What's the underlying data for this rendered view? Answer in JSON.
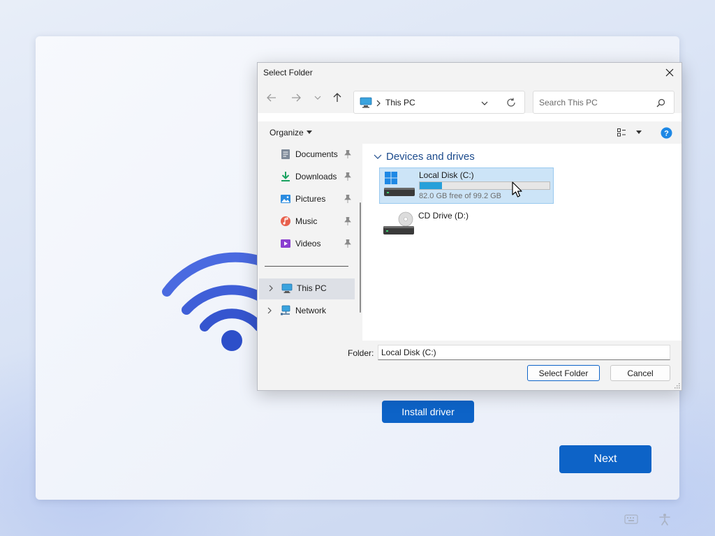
{
  "setup": {
    "install_button": "Install driver",
    "next_button": "Next"
  },
  "dialog": {
    "title": "Select Folder",
    "address": "This PC",
    "search_placeholder": "Search This PC",
    "organize": "Organize",
    "nav_items": [
      {
        "label": "Documents",
        "icon": "documents-icon",
        "pinned": true
      },
      {
        "label": "Downloads",
        "icon": "downloads-icon",
        "pinned": true
      },
      {
        "label": "Pictures",
        "icon": "pictures-icon",
        "pinned": true
      },
      {
        "label": "Music",
        "icon": "music-icon",
        "pinned": true
      },
      {
        "label": "Videos",
        "icon": "videos-icon",
        "pinned": true
      }
    ],
    "tree_items": [
      {
        "label": "This PC",
        "icon": "this-pc-icon",
        "selected": true
      },
      {
        "label": "Network",
        "icon": "network-icon",
        "selected": false
      }
    ],
    "group_header": "Devices and drives",
    "drives": [
      {
        "name": "Local Disk (C:)",
        "free_text": "82.0 GB free of 99.2 GB",
        "used_fraction": 0.173,
        "selected": true
      },
      {
        "name": "CD Drive (D:)",
        "selected": false
      }
    ],
    "folder_label": "Folder:",
    "folder_value": "Local Disk (C:)",
    "select_button": "Select Folder",
    "cancel_button": "Cancel"
  },
  "colors": {
    "accent": "#0d63c7",
    "wifi_light": "#4f6fe0",
    "wifi_dark": "#2d4fc9",
    "drive_bar": "#26a0da",
    "selection": "#cce4f7"
  }
}
